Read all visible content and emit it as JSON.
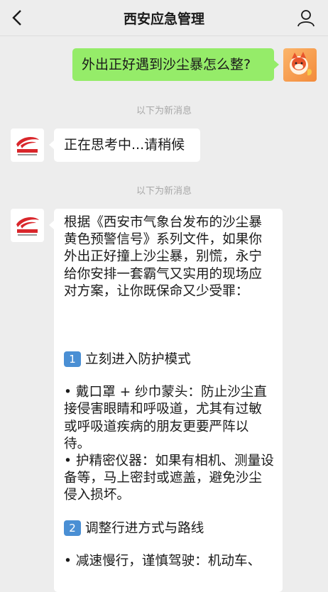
{
  "header": {
    "title": "西安应急管理",
    "back_icon": "chevron-left-icon",
    "profile_icon": "person-icon"
  },
  "messages": {
    "user_question": "外出正好遇到沙尘暴怎么整?",
    "divider_1": "以下为新消息",
    "thinking": "正在思考中...请稍候",
    "divider_2": "以下为新消息",
    "answer": {
      "intro": "根据《西安市气象台发布的沙尘暴黄色预警信号》系列文件，如果你外出正好撞上沙尘暴，别慌，永宁给你安排一套霸气又实用的现场应对方案，让你既保命又少受罪：",
      "section1_num": "1",
      "section1_title": "立刻进入防护模式",
      "bullet1": "• 戴口罩 + 纱巾蒙头：防止沙尘直接侵害眼睛和呼吸道，尤其有过敏或呼吸道疾病的朋友更要严阵以待。",
      "bullet2": "• 护精密仪器：如果有相机、测量设备等，马上密封或遮盖，避免沙尘侵入损坏。",
      "section2_num": "2",
      "section2_title": "调整行进方式与路线",
      "bullet3": "• 减速慢行，谨慎驾驶：机动车、"
    }
  },
  "colors": {
    "background": "#ededed",
    "outgoing_bubble": "#95ec69",
    "incoming_bubble": "#ffffff",
    "number_badge": "#4a8fd4"
  }
}
